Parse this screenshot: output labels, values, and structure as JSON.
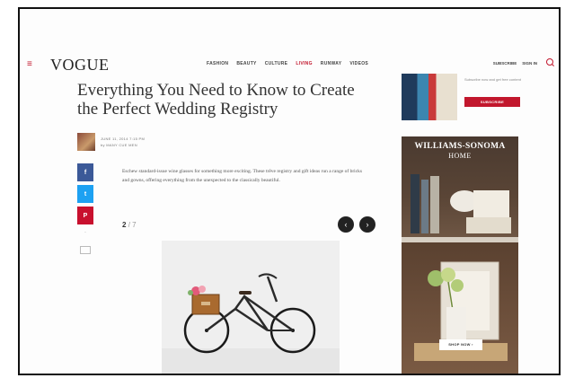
{
  "header": {
    "logo": "VOGUE",
    "menu_icon": "≡",
    "nav": [
      "FASHION",
      "BEAUTY",
      "CULTURE",
      "LIVING",
      "RUNWAY",
      "VIDEOS"
    ],
    "nav_active_index": 3,
    "right_links": [
      "SUBSCRIBE",
      "SIGN IN"
    ]
  },
  "article": {
    "title": "Everything You Need to Know to Create the Perfect Wedding Registry",
    "author_date": "JUNE 11, 2014 7:15 PM",
    "author_name": "by MANY CUE MEN",
    "caption": "Eschew standard-issue wine glasses for something more exciting. These trêve registry and gift ideas run a range of bricks and gowns, offering everything from the unexpected to the classically beautiful.",
    "slide_current": "2",
    "slide_total": "7",
    "slide_separator": "/"
  },
  "share": {
    "facebook": "f",
    "twitter": "t",
    "pinterest": "P"
  },
  "ads": {
    "top_text": "Subscribe now and get free content",
    "top_button": "SUBSCRIBE",
    "ws_brand": "WILLIAMS-SONOMA",
    "ws_sub": "HOME",
    "ws_button": "SHOP NOW ›"
  },
  "colors": {
    "accent": "#c2172d",
    "facebook": "#3b5998",
    "twitter": "#1da1f2",
    "pinterest": "#c8102e"
  },
  "icons": [
    "menu-icon",
    "search-icon",
    "arrow-left-icon",
    "arrow-right-icon",
    "comment-icon"
  ]
}
